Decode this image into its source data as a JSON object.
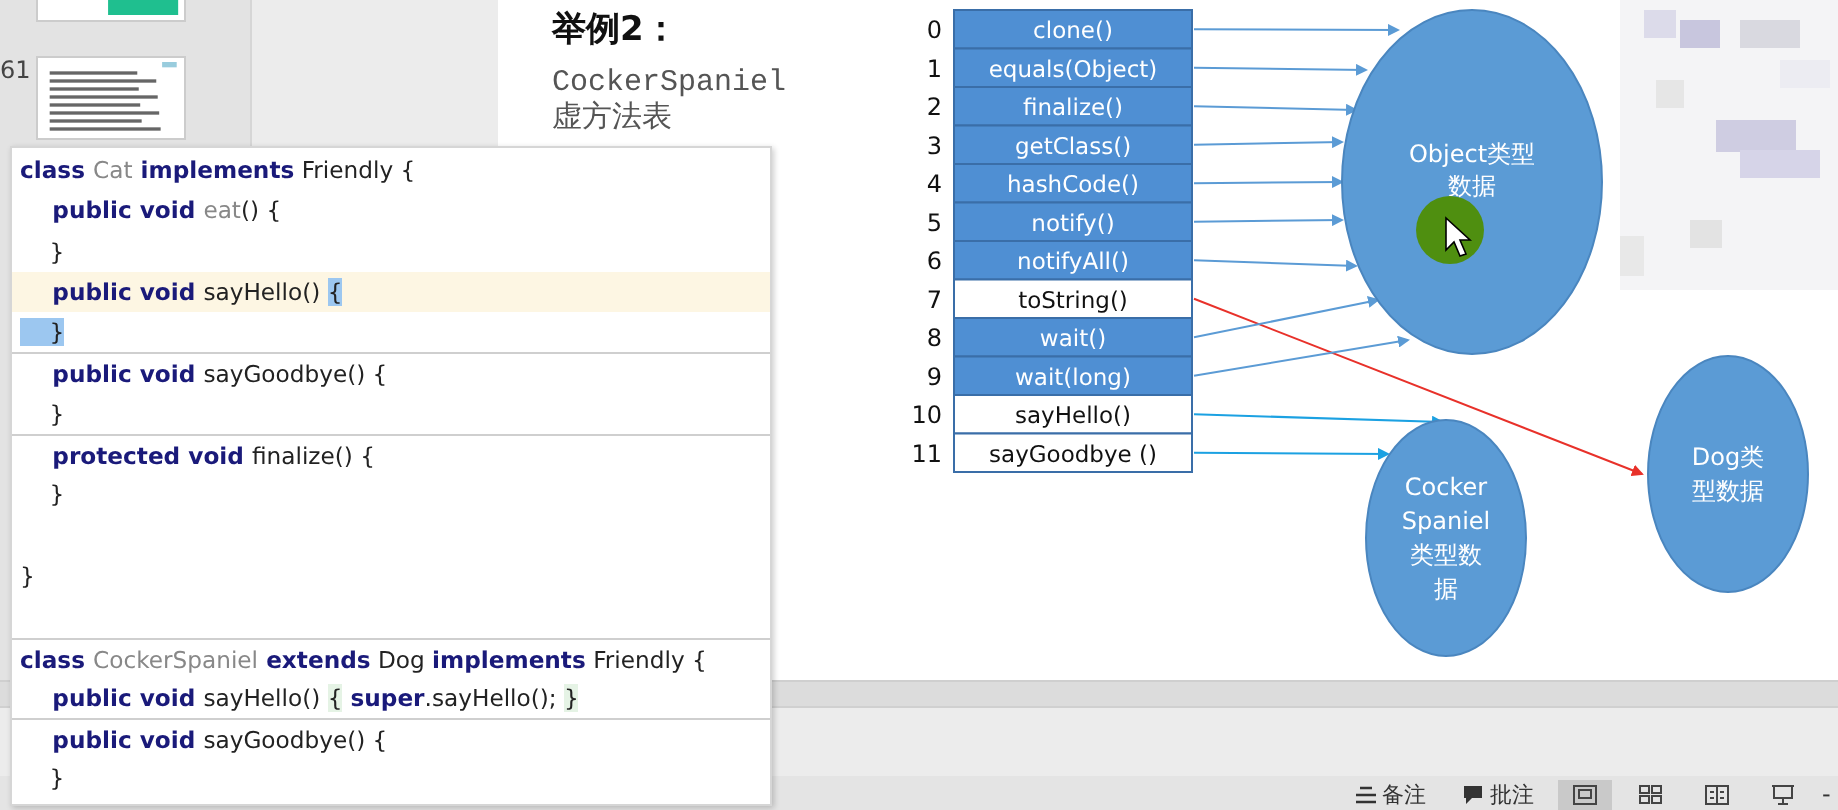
{
  "thumbnails": [
    {
      "kind": "picture"
    },
    {
      "kind": "picture",
      "number": "61"
    }
  ],
  "slide": {
    "title": "举例2：",
    "lines": [
      "CockerSpaniel",
      "虚方法表"
    ],
    "method_table": {
      "rows": [
        {
          "index": "0",
          "method": "clone()",
          "overridden": false
        },
        {
          "index": "1",
          "method": "equals(Object)",
          "overridden": false
        },
        {
          "index": "2",
          "method": "finalize()",
          "overridden": false
        },
        {
          "index": "3",
          "method": "getClass()",
          "overridden": false
        },
        {
          "index": "4",
          "method": "hashCode()",
          "overridden": false
        },
        {
          "index": "5",
          "method": "notify()",
          "overridden": false
        },
        {
          "index": "6",
          "method": "notifyAll()",
          "overridden": false
        },
        {
          "index": "7",
          "method": "toString()",
          "overridden": true
        },
        {
          "index": "8",
          "method": "wait()",
          "overridden": false
        },
        {
          "index": "9",
          "method": "wait(long)",
          "overridden": false
        },
        {
          "index": "10",
          "method": "sayHello()",
          "overridden": true
        },
        {
          "index": "11",
          "method": "sayGoodbye ()",
          "overridden": true
        }
      ]
    },
    "ellipses": [
      {
        "lines": [
          "Object类型",
          "数据"
        ]
      },
      {
        "lines": [
          "Cocker",
          "Spaniel",
          "类型数",
          "据"
        ]
      },
      {
        "lines": [
          "Dog类",
          "型数据"
        ]
      }
    ]
  },
  "code_popup": {
    "lines": [
      {
        "current": false,
        "divider_above": false,
        "tokens": [
          {
            "text": "class ",
            "kind": "keyword"
          },
          {
            "text": "Cat",
            "kind": "unused"
          },
          {
            "text": " implements",
            "kind": "keyword"
          },
          {
            "text": " Friendly {",
            "kind": "plain"
          }
        ]
      },
      {
        "current": false,
        "divider_above": false,
        "tokens": [
          {
            "text": "    public void ",
            "kind": "keyword"
          },
          {
            "text": "eat",
            "kind": "unused"
          },
          {
            "text": "() {",
            "kind": "plain"
          }
        ]
      },
      {
        "current": false,
        "divider_above": false,
        "tokens": [
          {
            "text": "    }",
            "kind": "plain"
          }
        ]
      },
      {
        "current": true,
        "divider_above": false,
        "tokens": [
          {
            "text": "    public void ",
            "kind": "keyword"
          },
          {
            "text": "sayHello() ",
            "kind": "plain"
          },
          {
            "text": "{",
            "kind": "match"
          }
        ]
      },
      {
        "current": false,
        "divider_above": false,
        "tokens": [
          {
            "text": "    }",
            "kind": "match"
          }
        ]
      },
      {
        "current": false,
        "divider_above": true,
        "tokens": [
          {
            "text": "    public void ",
            "kind": "keyword"
          },
          {
            "text": "sayGoodbye() {",
            "kind": "plain"
          }
        ]
      },
      {
        "current": false,
        "divider_above": false,
        "tokens": [
          {
            "text": "    }",
            "kind": "plain"
          }
        ]
      },
      {
        "current": false,
        "divider_above": true,
        "tokens": [
          {
            "text": "    protected void ",
            "kind": "keyword"
          },
          {
            "text": "finalize() {",
            "kind": "plain"
          }
        ]
      },
      {
        "current": false,
        "divider_above": false,
        "tokens": [
          {
            "text": "    }",
            "kind": "plain"
          }
        ]
      },
      {
        "current": false,
        "divider_above": false
      },
      {
        "current": false,
        "divider_above": false,
        "tokens": [
          {
            "text": "}",
            "kind": "plain"
          }
        ]
      },
      {
        "current": false,
        "divider_above": false
      },
      {
        "current": false,
        "divider_above": true,
        "tokens": [
          {
            "text": "class ",
            "kind": "keyword"
          },
          {
            "text": "CockerSpaniel",
            "kind": "unused"
          },
          {
            "text": " extends",
            "kind": "keyword"
          },
          {
            "text": " Dog ",
            "kind": "plain"
          },
          {
            "text": "implements",
            "kind": "keyword"
          },
          {
            "text": " Friendly {",
            "kind": "plain"
          }
        ]
      },
      {
        "current": false,
        "divider_above": false,
        "tokens": [
          {
            "text": "    public void ",
            "kind": "keyword"
          },
          {
            "text": "sayHello() ",
            "kind": "plain"
          },
          {
            "text": "{",
            "kind": "hint"
          },
          {
            "text": " super",
            "kind": "keyword"
          },
          {
            "text": ".sayHello(); ",
            "kind": "plain"
          },
          {
            "text": "}",
            "kind": "hint"
          }
        ]
      },
      {
        "current": false,
        "divider_above": true,
        "tokens": [
          {
            "text": "    public void ",
            "kind": "keyword"
          },
          {
            "text": "sayGoodbye() {",
            "kind": "plain"
          }
        ]
      },
      {
        "current": false,
        "divider_above": false,
        "tokens": [
          {
            "text": "    }",
            "kind": "plain"
          }
        ]
      }
    ]
  },
  "status_bar": {
    "notes": "备注",
    "comments": "批注",
    "views": [
      {
        "selected": true
      },
      {
        "selected": false
      },
      {
        "selected": false
      },
      {
        "selected": false
      }
    ],
    "zoom_out": "-"
  }
}
